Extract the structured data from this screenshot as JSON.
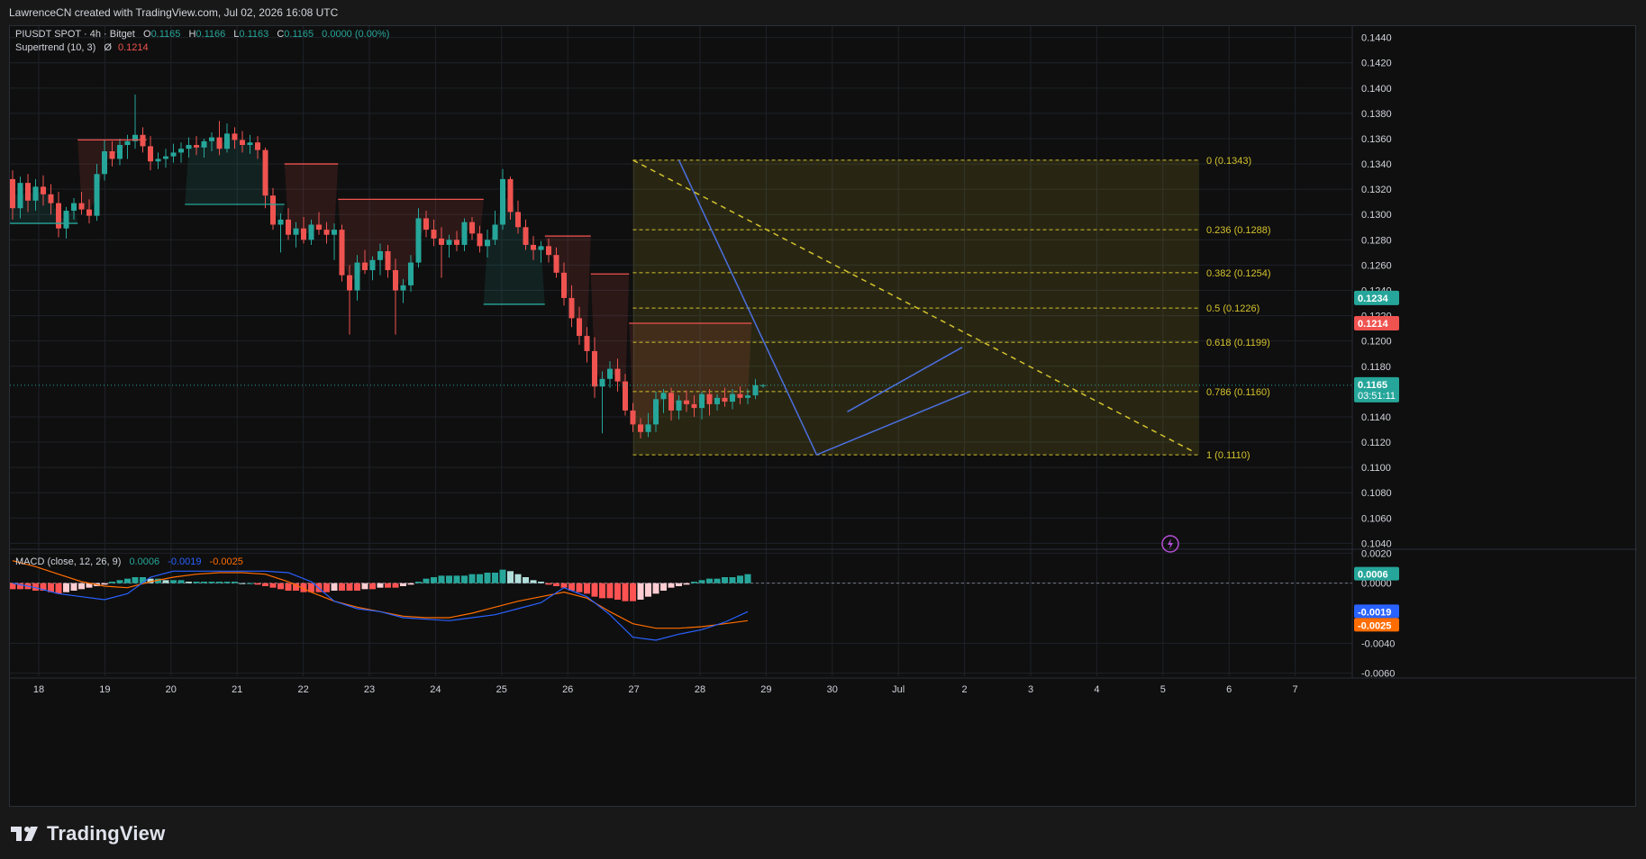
{
  "header": {
    "attribution": "LawrenceCN created with TradingView.com, Jul 02, 2026 16:08 UTC"
  },
  "legend": {
    "symbol": "PIUSDT SPOT · 4h · Bitget",
    "o_label": "O",
    "o_value": "0.1165",
    "h_label": "H",
    "h_value": "0.1166",
    "l_label": "L",
    "l_value": "0.1163",
    "c_label": "C",
    "c_value": "0.1165",
    "change": "0.0000 (0.00%)",
    "supertrend_label": "Supertrend (10, 3)",
    "supertrend_symbol": "Ø",
    "supertrend_value": "0.1214",
    "macd_label": "MACD (close, 12, 26, 9)",
    "macd_hist": "0.0006",
    "macd_line": "-0.0019",
    "macd_signal": "-0.0025"
  },
  "footer": {
    "brand": "TradingView"
  },
  "colors": {
    "up": "#26a69a",
    "down": "#ef5350",
    "fib": "#d4c22d",
    "trendline": "#4c6fe0",
    "macd_line": "#2962ff",
    "signal_line": "#ff6d00",
    "background": "#0f0f0f",
    "grid": "#1e2228"
  },
  "chart_data": [
    {
      "type": "candlestick",
      "title": "PIUSDT SPOT · 4h · Bitget",
      "timeframe": "4h",
      "y_axis_ticks": [
        "0.1440",
        "0.1420",
        "0.1400",
        "0.1380",
        "0.1360",
        "0.1340",
        "0.1320",
        "0.1300",
        "0.1280",
        "0.1260",
        "0.1240",
        "0.1220",
        "0.1200",
        "0.1180",
        "0.1140",
        "0.1120",
        "0.1100",
        "0.1080",
        "0.1060",
        "0.1040"
      ],
      "ylim": [
        0.1036,
        0.1449
      ],
      "x_axis_ticks": [
        "18",
        "19",
        "20",
        "21",
        "22",
        "23",
        "24",
        "25",
        "26",
        "27",
        "28",
        "29",
        "30",
        "Jul",
        "2",
        "3",
        "4",
        "5",
        "6",
        "7"
      ],
      "candles": [
        [
          0.1328,
          0.1335,
          0.1296,
          0.1305
        ],
        [
          0.1305,
          0.133,
          0.1297,
          0.1325
        ],
        [
          0.1325,
          0.1332,
          0.1302,
          0.1311
        ],
        [
          0.1311,
          0.1328,
          0.1303,
          0.1322
        ],
        [
          0.1322,
          0.1331,
          0.1307,
          0.1316
        ],
        [
          0.1316,
          0.1324,
          0.13,
          0.1309
        ],
        [
          0.1309,
          0.1318,
          0.1282,
          0.1289
        ],
        [
          0.1289,
          0.1306,
          0.1281,
          0.1303
        ],
        [
          0.1303,
          0.1313,
          0.1296,
          0.1309
        ],
        [
          0.1309,
          0.1318,
          0.13,
          0.1304
        ],
        [
          0.1304,
          0.1312,
          0.1293,
          0.1299
        ],
        [
          0.1299,
          0.134,
          0.1295,
          0.1332
        ],
        [
          0.1332,
          0.1359,
          0.1327,
          0.135
        ],
        [
          0.135,
          0.1358,
          0.1338,
          0.1344
        ],
        [
          0.1344,
          0.136,
          0.1339,
          0.1355
        ],
        [
          0.1355,
          0.1363,
          0.1344,
          0.1358
        ],
        [
          0.1358,
          0.1395,
          0.1352,
          0.1363
        ],
        [
          0.1363,
          0.1369,
          0.1349,
          0.1354
        ],
        [
          0.1354,
          0.1362,
          0.1335,
          0.1342
        ],
        [
          0.1342,
          0.1349,
          0.1336,
          0.1344
        ],
        [
          0.1344,
          0.1352,
          0.1337,
          0.1346
        ],
        [
          0.1346,
          0.1356,
          0.1341,
          0.1349
        ],
        [
          0.1349,
          0.1357,
          0.1341,
          0.1352
        ],
        [
          0.1352,
          0.1361,
          0.1345,
          0.1355
        ],
        [
          0.1355,
          0.1362,
          0.1347,
          0.1353
        ],
        [
          0.1353,
          0.136,
          0.1345,
          0.1358
        ],
        [
          0.1358,
          0.1365,
          0.135,
          0.1361
        ],
        [
          0.1361,
          0.1374,
          0.1347,
          0.1352
        ],
        [
          0.1352,
          0.1372,
          0.1349,
          0.1364
        ],
        [
          0.1364,
          0.1369,
          0.1352,
          0.1359
        ],
        [
          0.1359,
          0.1366,
          0.1349,
          0.1355
        ],
        [
          0.1355,
          0.1363,
          0.1348,
          0.1357
        ],
        [
          0.1357,
          0.1362,
          0.1344,
          0.1351
        ],
        [
          0.1351,
          0.1353,
          0.1305,
          0.1315
        ],
        [
          0.1315,
          0.1321,
          0.1288,
          0.1292
        ],
        [
          0.1292,
          0.1301,
          0.127,
          0.1296
        ],
        [
          0.1296,
          0.1305,
          0.128,
          0.1284
        ],
        [
          0.1284,
          0.1294,
          0.1274,
          0.1289
        ],
        [
          0.1289,
          0.1298,
          0.1277,
          0.128
        ],
        [
          0.128,
          0.1296,
          0.1276,
          0.1292
        ],
        [
          0.1292,
          0.1302,
          0.1284,
          0.1288
        ],
        [
          0.1288,
          0.1294,
          0.1277,
          0.1284
        ],
        [
          0.1284,
          0.1293,
          0.1264,
          0.1288
        ],
        [
          0.1288,
          0.1292,
          0.1247,
          0.1252
        ],
        [
          0.1252,
          0.126,
          0.1205,
          0.124
        ],
        [
          0.124,
          0.1268,
          0.1232,
          0.1262
        ],
        [
          0.1262,
          0.1272,
          0.1253,
          0.1256
        ],
        [
          0.1256,
          0.1267,
          0.1248,
          0.1264
        ],
        [
          0.1264,
          0.1277,
          0.1252,
          0.1271
        ],
        [
          0.1271,
          0.1276,
          0.125,
          0.1256
        ],
        [
          0.1256,
          0.1265,
          0.1205,
          0.124
        ],
        [
          0.124,
          0.1249,
          0.123,
          0.1244
        ],
        [
          0.1244,
          0.1268,
          0.1239,
          0.1262
        ],
        [
          0.1262,
          0.1305,
          0.1258,
          0.1297
        ],
        [
          0.1297,
          0.1303,
          0.1282,
          0.1288
        ],
        [
          0.1288,
          0.1296,
          0.1275,
          0.1281
        ],
        [
          0.1281,
          0.129,
          0.125,
          0.1276
        ],
        [
          0.1276,
          0.1284,
          0.1266,
          0.128
        ],
        [
          0.128,
          0.1287,
          0.1271,
          0.1276
        ],
        [
          0.1276,
          0.1297,
          0.1271,
          0.1294
        ],
        [
          0.1294,
          0.1298,
          0.128,
          0.1285
        ],
        [
          0.1285,
          0.1291,
          0.127,
          0.1275
        ],
        [
          0.1275,
          0.1288,
          0.1266,
          0.128
        ],
        [
          0.128,
          0.1303,
          0.1276,
          0.1292
        ],
        [
          0.1292,
          0.1336,
          0.1288,
          0.1328
        ],
        [
          0.1328,
          0.133,
          0.1296,
          0.1302
        ],
        [
          0.1302,
          0.1311,
          0.1285,
          0.129
        ],
        [
          0.129,
          0.1296,
          0.1272,
          0.1276
        ],
        [
          0.1276,
          0.1283,
          0.1264,
          0.1272
        ],
        [
          0.1272,
          0.1279,
          0.1262,
          0.1275
        ],
        [
          0.1275,
          0.1281,
          0.1262,
          0.1268
        ],
        [
          0.1268,
          0.1274,
          0.125,
          0.1254
        ],
        [
          0.1254,
          0.1262,
          0.1228,
          0.1234
        ],
        [
          0.1234,
          0.1244,
          0.1211,
          0.1218
        ],
        [
          0.1218,
          0.1227,
          0.1197,
          0.1204
        ],
        [
          0.1204,
          0.1211,
          0.1183,
          0.1192
        ],
        [
          0.1192,
          0.1203,
          0.1155,
          0.1164
        ],
        [
          0.1164,
          0.1176,
          0.1127,
          0.117
        ],
        [
          0.117,
          0.1184,
          0.1163,
          0.1178
        ],
        [
          0.1178,
          0.1186,
          0.116,
          0.1168
        ],
        [
          0.1168,
          0.1174,
          0.1141,
          0.1145
        ],
        [
          0.1145,
          0.1151,
          0.1128,
          0.1134
        ],
        [
          0.1134,
          0.1139,
          0.1123,
          0.1128
        ],
        [
          0.1128,
          0.1143,
          0.1124,
          0.1134
        ],
        [
          0.1134,
          0.116,
          0.1128,
          0.1154
        ],
        [
          0.1154,
          0.1162,
          0.1143,
          0.1159
        ],
        [
          0.1159,
          0.1163,
          0.1137,
          0.1145
        ],
        [
          0.1145,
          0.1157,
          0.1138,
          0.1153
        ],
        [
          0.1153,
          0.1161,
          0.1144,
          0.115
        ],
        [
          0.115,
          0.1157,
          0.114,
          0.1147
        ],
        [
          0.1147,
          0.116,
          0.1138,
          0.1158
        ],
        [
          0.1158,
          0.1162,
          0.1141,
          0.115
        ],
        [
          0.115,
          0.1158,
          0.1145,
          0.1155
        ],
        [
          0.1155,
          0.1163,
          0.1148,
          0.1152
        ],
        [
          0.1152,
          0.1162,
          0.1146,
          0.1158
        ],
        [
          0.1158,
          0.1164,
          0.115,
          0.1155
        ],
        [
          0.1155,
          0.1162,
          0.115,
          0.1157
        ],
        [
          0.1157,
          0.117,
          0.1154,
          0.1165
        ],
        [
          0.1165,
          0.1166,
          0.1163,
          0.1165
        ]
      ],
      "supertrend": {
        "current": 0.1214,
        "segments": [
          {
            "dir": "down",
            "from": 9,
            "to": 17,
            "value": 0.1359
          },
          {
            "dir": "up",
            "from": 0,
            "to": 8,
            "value": 0.1293
          },
          {
            "dir": "up",
            "from": 23,
            "to": 35,
            "value": 0.1308
          },
          {
            "dir": "down",
            "from": 36,
            "to": 42,
            "value": 0.134
          },
          {
            "dir": "down",
            "from": 43,
            "to": 61,
            "value": 0.1312
          },
          {
            "dir": "up",
            "from": 62,
            "to": 69,
            "value": 0.1229
          },
          {
            "dir": "down",
            "from": 70,
            "to": 75,
            "value": 0.1283
          },
          {
            "dir": "down",
            "from": 76,
            "to": 80,
            "value": 0.1253
          },
          {
            "dir": "down",
            "from": 81,
            "to": 96,
            "value": 0.1214
          }
        ]
      },
      "fibonacci": [
        {
          "level": "0",
          "label": "0 (0.1343)",
          "price": 0.1343
        },
        {
          "level": "0.236",
          "label": "0.236 (0.1288)",
          "price": 0.1288
        },
        {
          "level": "0.382",
          "label": "0.382 (0.1254)",
          "price": 0.1254
        },
        {
          "level": "0.5",
          "label": "0.5 (0.1226)",
          "price": 0.1226
        },
        {
          "level": "0.618",
          "label": "0.618 (0.1199)",
          "price": 0.1199
        },
        {
          "level": "0.786",
          "label": "0.786 (0.1160)",
          "price": 0.116
        },
        {
          "level": "1",
          "label": "1 (0.1110)",
          "price": 0.111
        }
      ],
      "price_tags": [
        {
          "text": "0.1234",
          "value": 0.1234,
          "color": "#26a69a"
        },
        {
          "text": "0.1214",
          "value": 0.1214,
          "color": "#ef5350"
        },
        {
          "text": "0.1165",
          "value": 0.1165,
          "color": "#26a69a",
          "sub": "03:51:11"
        }
      ]
    },
    {
      "type": "histogram",
      "title": "MACD (close, 12, 26, 9)",
      "y_axis_ticks": [
        "0.0020",
        "0.0000",
        "-0.0040",
        "-0.0060"
      ],
      "ylim": [
        -0.0062,
        0.0022
      ],
      "histogram": [
        -0.0004,
        -0.0004,
        -0.0004,
        -0.0005,
        -0.0005,
        -0.0006,
        -0.0007,
        -0.0006,
        -0.0005,
        -0.0004,
        -0.0003,
        -0.0002,
        -0.0001,
        0.0001,
        0.0002,
        0.0003,
        0.0004,
        0.0004,
        0.0003,
        0.0003,
        0.0002,
        0.0002,
        0.0002,
        0.0001,
        0.0001,
        0.0001,
        0.0001,
        0.0001,
        0.0001,
        0.0001,
        0.0,
        0.0,
        -0.0001,
        -0.0002,
        -0.0003,
        -0.0004,
        -0.0005,
        -0.0005,
        -0.0006,
        -0.0006,
        -0.0006,
        -0.0006,
        -0.0005,
        -0.0005,
        -0.0005,
        -0.0005,
        -0.0004,
        -0.0004,
        -0.0003,
        -0.0003,
        -0.0003,
        -0.0002,
        -0.0001,
        0.0001,
        0.0003,
        0.0004,
        0.0005,
        0.0005,
        0.0005,
        0.0005,
        0.0006,
        0.0006,
        0.0007,
        0.0007,
        0.0009,
        0.0008,
        0.0006,
        0.0004,
        0.0002,
        0.0001,
        -0.0001,
        -0.0002,
        -0.0003,
        -0.0005,
        -0.0006,
        -0.0007,
        -0.0009,
        -0.001,
        -0.001,
        -0.0011,
        -0.0012,
        -0.0012,
        -0.0011,
        -0.0009,
        -0.0007,
        -0.0005,
        -0.0003,
        -0.0002,
        -0.0001,
        0.0001,
        0.0002,
        0.0003,
        0.0003,
        0.0004,
        0.0004,
        0.0005,
        0.0006
      ],
      "macd": [
        -0.0,
        -0.0003,
        -0.0007,
        -0.0009,
        -0.0011,
        -0.0007,
        0.0004,
        0.0008,
        0.0008,
        0.0008,
        0.0008,
        0.0008,
        0.0007,
        0.0001,
        -0.0012,
        -0.0017,
        -0.0019,
        -0.0023,
        -0.0024,
        -0.0025,
        -0.0023,
        -0.0021,
        -0.0017,
        -0.0013,
        -0.0003,
        -0.0009,
        -0.0021,
        -0.0036,
        -0.0038,
        -0.0034,
        -0.0031,
        -0.0026,
        -0.0019
      ],
      "signal": [
        0.0015,
        0.0011,
        0.0006,
        0.0001,
        -0.0002,
        -0.0003,
        0.0001,
        0.0004,
        0.0006,
        0.0007,
        0.0007,
        0.0006,
        0.0001,
        -0.0006,
        -0.0012,
        -0.0016,
        -0.0019,
        -0.0022,
        -0.0023,
        -0.0023,
        -0.002,
        -0.0016,
        -0.0012,
        -0.0009,
        -0.0006,
        -0.001,
        -0.0019,
        -0.0027,
        -0.003,
        -0.003,
        -0.0029,
        -0.0027,
        -0.0025
      ]
    }
  ]
}
